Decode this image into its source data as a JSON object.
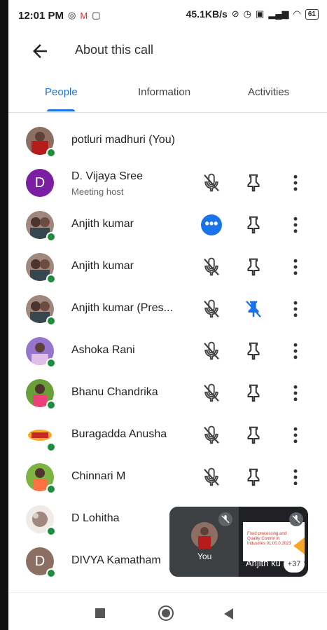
{
  "status_bar": {
    "time": "12:01 PM",
    "speed": "45.1KB/s",
    "battery": "61"
  },
  "header": {
    "title": "About this call"
  },
  "tabs": [
    {
      "label": "People"
    },
    {
      "label": "Information"
    },
    {
      "label": "Activities"
    }
  ],
  "participants": [
    {
      "name": "potluri madhuri (You)"
    },
    {
      "name": "D. Vijaya Sree",
      "role": "Meeting host",
      "initial": "D"
    },
    {
      "name": "Anjith kumar"
    },
    {
      "name": "Anjith kumar"
    },
    {
      "name": "Anjith kumar (Pres..."
    },
    {
      "name": "Ashoka Rani"
    },
    {
      "name": "Bhanu Chandrika"
    },
    {
      "name": "Buragadda Anusha"
    },
    {
      "name": "Chinnari M"
    },
    {
      "name": "D Lohitha"
    },
    {
      "name": "DIVYA Kamatham",
      "initial": "D"
    }
  ],
  "pip": {
    "you_label": "You",
    "presenter_label": "Anjith ku",
    "more_count": "+37",
    "slide_text": "Food processing and Quality Control in Industries 01.00.0.2023"
  },
  "colors": {
    "accent": "#1a73e8",
    "online": "#1e8e3e",
    "pinned": "#1a73e8"
  }
}
